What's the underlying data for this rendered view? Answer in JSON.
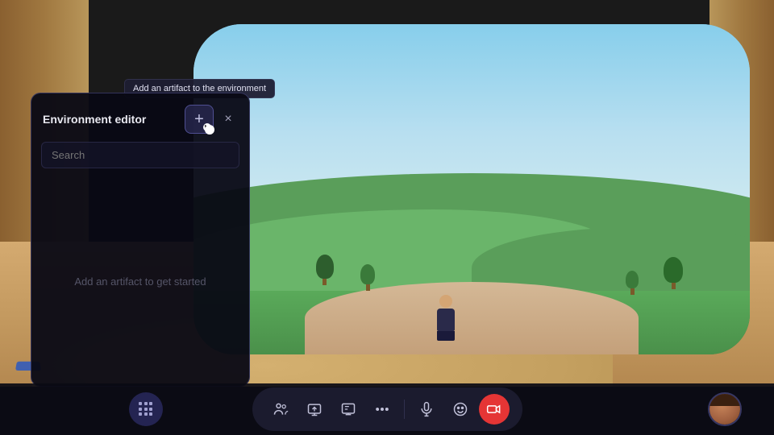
{
  "environment": {
    "background_color": "#1a1a1a"
  },
  "panel": {
    "title": "Environment editor",
    "search_placeholder": "Search",
    "empty_state_text": "Add an artifact to get started",
    "tooltip_text": "Add an artifact to the environment",
    "add_button_label": "+",
    "close_button_label": "×"
  },
  "toolbar": {
    "buttons": [
      {
        "id": "people",
        "label": "People",
        "icon": "people-icon"
      },
      {
        "id": "screen-share",
        "label": "Screen share",
        "icon": "screen-share-icon"
      },
      {
        "id": "whiteboard",
        "label": "Whiteboard",
        "icon": "whiteboard-icon"
      },
      {
        "id": "more",
        "label": "More",
        "icon": "more-icon"
      },
      {
        "id": "mic",
        "label": "Microphone",
        "icon": "mic-icon"
      },
      {
        "id": "emoji",
        "label": "Emoji",
        "icon": "emoji-icon"
      },
      {
        "id": "camera",
        "label": "Camera",
        "icon": "camera-icon",
        "active": true
      }
    ],
    "apps_label": "Apps",
    "avatar_label": "User avatar"
  }
}
